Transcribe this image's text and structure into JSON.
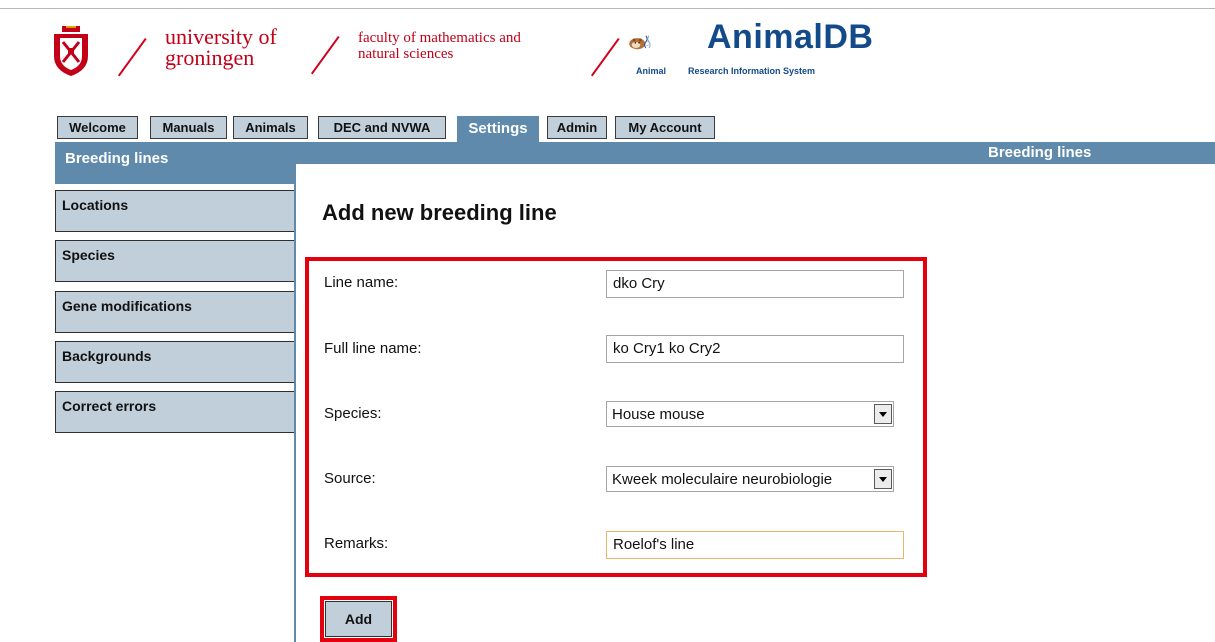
{
  "header": {
    "university_line1": "university of",
    "university_line2": "groningen",
    "faculty_line1": "faculty of mathematics and",
    "faculty_line2": "natural sciences",
    "app_name": "AnimalDB",
    "app_sub_1": "Animal",
    "app_sub_2": "Research Information System",
    "brand_red": "#c20018",
    "brand_blue": "#124a8a"
  },
  "tabs": [
    {
      "label": "Welcome"
    },
    {
      "label": "Manuals"
    },
    {
      "label": "Animals"
    },
    {
      "label": "DEC and NVWA"
    },
    {
      "label": "Settings",
      "active": true
    },
    {
      "label": "Admin"
    },
    {
      "label": "My Account"
    }
  ],
  "page_title_bar": "Breeding lines",
  "sidebar": {
    "active": "Breeding lines",
    "items": [
      {
        "label": "Locations"
      },
      {
        "label": "Species"
      },
      {
        "label": "Gene modifications"
      },
      {
        "label": "Backgrounds"
      },
      {
        "label": "Correct errors"
      }
    ]
  },
  "form": {
    "heading": "Add new breeding line",
    "line_name": {
      "label": "Line name:",
      "value": "dko Cry"
    },
    "full_line_name": {
      "label": "Full line name:",
      "value": "ko Cry1 ko Cry2"
    },
    "species": {
      "label": "Species:",
      "selected": "House mouse"
    },
    "source": {
      "label": "Source:",
      "selected": "Kweek moleculaire neurobiologie"
    },
    "remarks": {
      "label": "Remarks:",
      "value": "Roelof's line"
    },
    "add_button": "Add"
  },
  "colors": {
    "accent_blue": "#5f8aac",
    "tab_gray": "#c1cfda",
    "highlight_red": "#e3000f"
  }
}
